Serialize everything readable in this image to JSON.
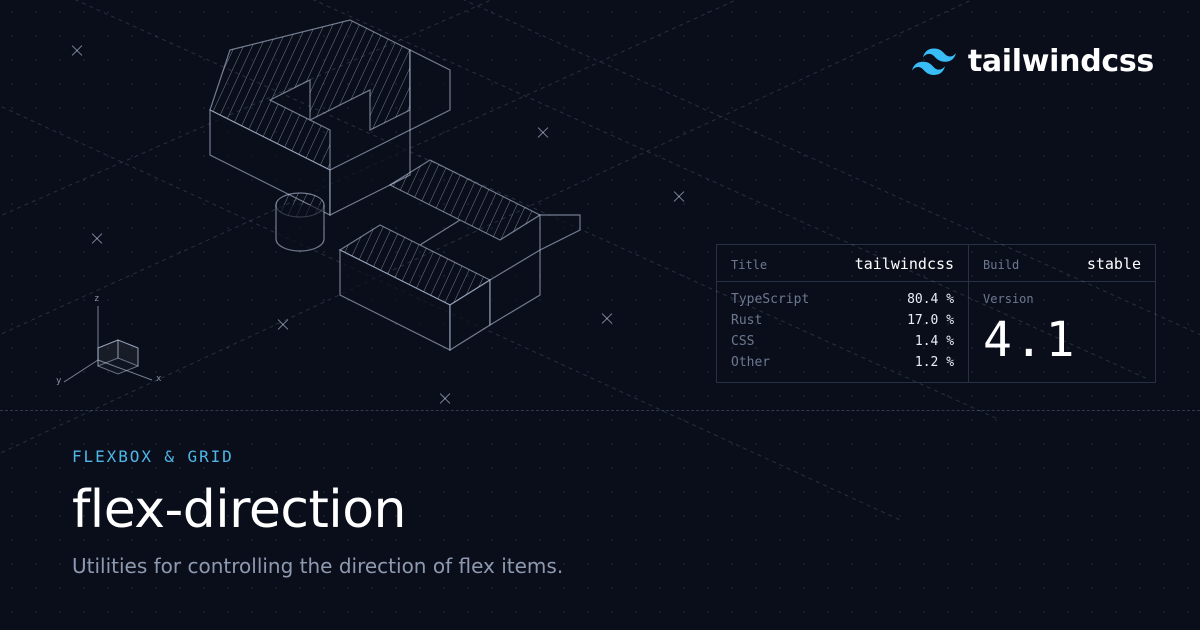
{
  "brand": {
    "name": "tailwindcss",
    "accent_color": "#38bdf8"
  },
  "axes_labels": {
    "x": "x",
    "y": "y",
    "z": "z"
  },
  "info": {
    "title_label": "Title",
    "title_value": "tailwindcss",
    "build_label": "Build",
    "build_value": "stable",
    "version_label": "Version",
    "version_value": "4.1",
    "languages": [
      {
        "name": "TypeScript",
        "percent": "80.4 %"
      },
      {
        "name": "Rust",
        "percent": "17.0 %"
      },
      {
        "name": "CSS",
        "percent": "1.4 %"
      },
      {
        "name": "Other",
        "percent": "1.2 %"
      }
    ]
  },
  "page": {
    "category": "FLEXBOX & GRID",
    "title": "flex-direction",
    "subtitle": "Utilities for controlling the direction of flex items."
  }
}
